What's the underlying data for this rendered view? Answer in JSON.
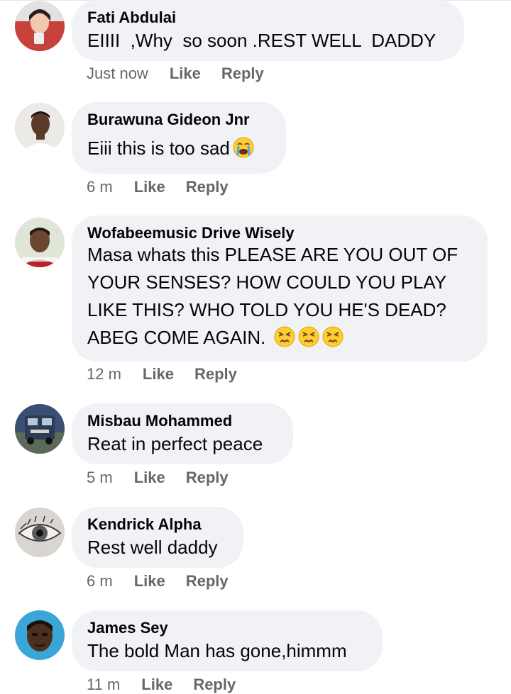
{
  "comments": [
    {
      "author": "Fati Abdulai",
      "text": "EIIII  ,Why  so soon .REST WELL  DADDY",
      "time": "Just now",
      "like": "Like",
      "reply": "Reply",
      "avatar_icon": "woman-avatar"
    },
    {
      "author": "Burawuna Gideon Jnr",
      "text": "Eiii this is too sad",
      "time": "6 m",
      "like": "Like",
      "reply": "Reply",
      "avatar_icon": "man-avatar",
      "emoji": [
        "loudly-crying-face"
      ]
    },
    {
      "author": "Wofabeemusic Drive Wisely",
      "text": "Masa whats this PLEASE ARE YOU OUT OF YOUR SENSES? HOW COULD YOU PLAY LIKE THIS? WHO TOLD YOU HE'S DEAD? ABEG COME AGAIN.",
      "time": "12 m",
      "like": "Like",
      "reply": "Reply",
      "avatar_icon": "man-avatar",
      "emoji": [
        "persevering-face",
        "persevering-face",
        "persevering-face"
      ]
    },
    {
      "author": "Misbau Mohammed",
      "text": "Reat in perfect peace",
      "time": "5 m",
      "like": "Like",
      "reply": "Reply",
      "avatar_icon": "truck-avatar"
    },
    {
      "author": "Kendrick Alpha",
      "text": "Rest well daddy",
      "time": "6 m",
      "like": "Like",
      "reply": "Reply",
      "avatar_icon": "eye-drawing-avatar"
    },
    {
      "author": "James Sey",
      "text": "The bold Man has gone,himmm",
      "time": "11 m",
      "like": "Like",
      "reply": "Reply",
      "avatar_icon": "man-avatar"
    }
  ],
  "colors": {
    "bubble": "#f0f2f5",
    "meta": "#65676b",
    "text": "#050505"
  }
}
